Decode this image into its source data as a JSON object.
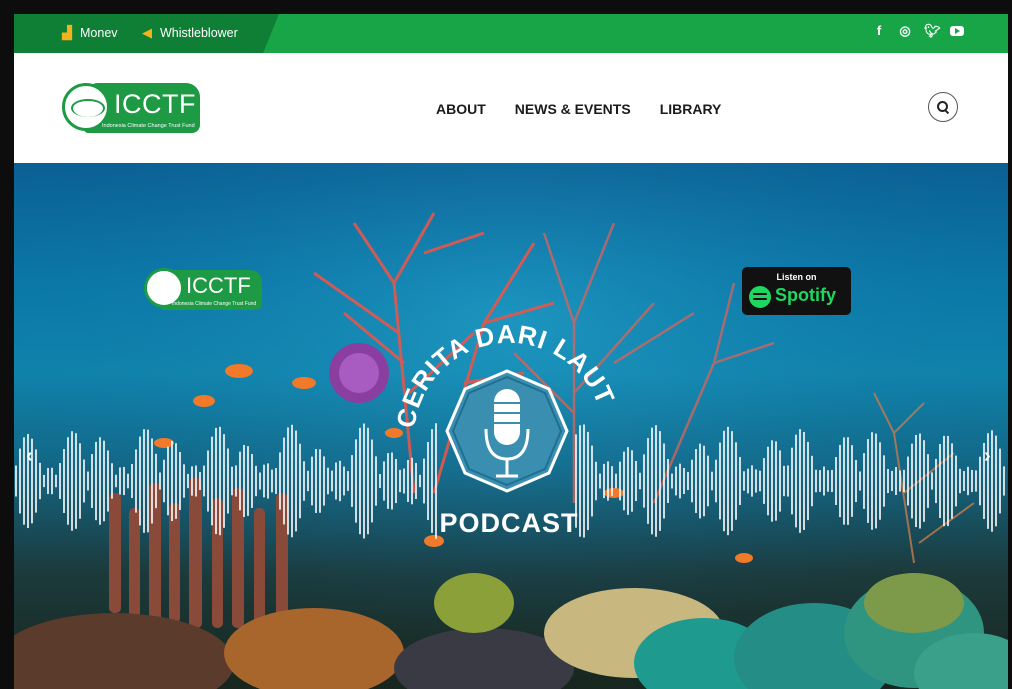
{
  "topbar": {
    "links": [
      {
        "label": "Monev",
        "icon": "chart-icon"
      },
      {
        "label": "Whistleblower",
        "icon": "megaphone-icon"
      }
    ],
    "social": [
      "facebook-icon",
      "instagram-icon",
      "twitter-icon",
      "youtube-icon"
    ],
    "colors": {
      "bar": "#18a548",
      "left_panel": "#0f7f35",
      "icon_accent": "#f3b21b"
    }
  },
  "header": {
    "logo": {
      "text": "ICCTF",
      "subtitle": "Indonesia Climate Change Trust Fund"
    },
    "nav": [
      "ABOUT",
      "NEWS & EVENTS",
      "LIBRARY"
    ],
    "search_icon": "search-icon"
  },
  "hero": {
    "logo": {
      "text": "ICCTF",
      "subtitle": "Indonesia Climate Change Trust Fund"
    },
    "arc_title": "CERITA DARI LAUT",
    "podcast_label": "PODCAST",
    "spotify": {
      "listen": "Listen on",
      "name": "Spotify"
    },
    "arrows": {
      "prev": "‹",
      "next": "›"
    }
  }
}
